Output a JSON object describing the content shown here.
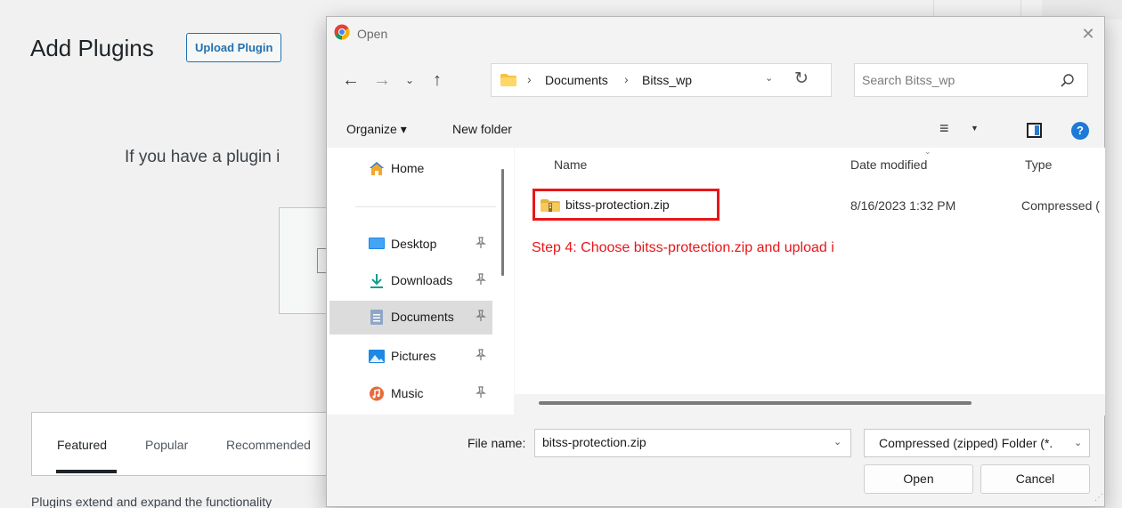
{
  "wp": {
    "title": "Add Plugins",
    "upload_button": "Upload Plugin",
    "intro": "If you have a plugin i",
    "tabs": [
      "Featured",
      "Popular",
      "Recommended"
    ],
    "footer_text": "Plugins extend and expand the functionality"
  },
  "dialog": {
    "title": "Open",
    "close": "✕",
    "nav": {
      "back": "←",
      "forward": "→",
      "recent": "⌄",
      "up": "↑"
    },
    "breadcrumb": [
      "Documents",
      "Bitss_wp"
    ],
    "search_placeholder": "Search Bitss_wp",
    "toolbar": {
      "organize": "Organize ▾",
      "new_folder": "New folder",
      "view": "≡",
      "help": "?"
    },
    "sidebar": [
      "Home",
      "Desktop",
      "Downloads",
      "Documents",
      "Pictures",
      "Music"
    ],
    "columns": {
      "name": "Name",
      "date": "Date modified",
      "type": "Type"
    },
    "file": {
      "name": "bitss-protection.zip",
      "date": "8/16/2023 1:32 PM",
      "type": "Compressed ("
    },
    "annotation": "Step 4: Choose bitss-protection.zip and upload i",
    "file_name_label": "File name:",
    "file_name_value": "bitss-protection.zip",
    "filter": "Compressed (zipped) Folder (*.",
    "open_button": "Open",
    "cancel_button": "Cancel"
  },
  "colors": {
    "wp_accent": "#2271b1",
    "annotation_red": "#e8161a",
    "selection": "#dcdcdc",
    "help_blue": "#1f79d6"
  },
  "icons": {
    "sidebar": [
      "home-icon",
      "desktop-icon",
      "downloads-icon",
      "documents-icon",
      "pictures-icon",
      "music-icon"
    ],
    "file": "zip-folder-icon"
  }
}
